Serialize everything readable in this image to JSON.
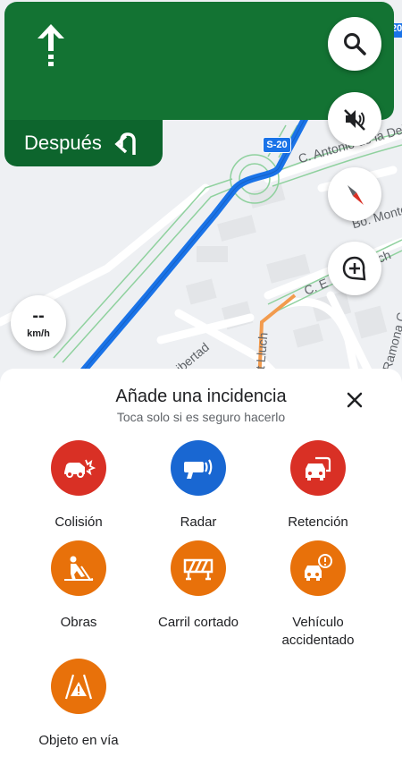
{
  "navigation": {
    "then_label": "Después"
  },
  "map": {
    "route_shield": "S-20",
    "route_shield_partial": "20",
    "streets": [
      "C. Antonio de la Dehe",
      "Bo. Monte",
      "C. E",
      "ch",
      "Libertad",
      "t Lluch",
      "Ramona C"
    ]
  },
  "speedometer": {
    "value": "--",
    "unit": "km/h"
  },
  "sheet": {
    "title": "Añade una incidencia",
    "subtitle": "Toca solo si es seguro hacerlo",
    "items": [
      {
        "label": "Colisión",
        "icon": "collision-icon",
        "color": "#d93025"
      },
      {
        "label": "Radar",
        "icon": "speed-camera-icon",
        "color": "#1967d2"
      },
      {
        "label": "Retención",
        "icon": "traffic-jam-icon",
        "color": "#d93025"
      },
      {
        "label": "Obras",
        "icon": "construction-icon",
        "color": "#e8710a"
      },
      {
        "label": "Carril cortado",
        "icon": "lane-closure-icon",
        "color": "#e8710a"
      },
      {
        "label": "Vehículo accidentado",
        "icon": "stalled-vehicle-icon",
        "color": "#e8710a"
      },
      {
        "label": "Objeto en vía",
        "icon": "road-hazard-icon",
        "color": "#e8710a"
      }
    ]
  },
  "colors": {
    "nav_green": "#137333",
    "nav_green_dark": "#0d652d",
    "route_blue": "#1a73e8"
  }
}
